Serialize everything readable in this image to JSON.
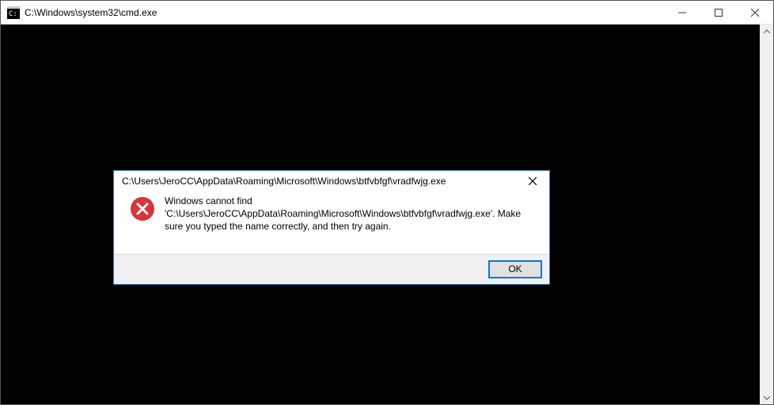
{
  "window": {
    "title": "C:\\Windows\\system32\\cmd.exe"
  },
  "dialog": {
    "title": "C:\\Users\\JeroCC\\AppData\\Roaming\\Microsoft\\Windows\\btfvbfgf\\vradfwjg.exe",
    "message": "Windows cannot find 'C:\\Users\\JeroCC\\AppData\\Roaming\\Microsoft\\Windows\\btfvbfgf\\vradfwjg.exe'. Make sure you typed the name correctly, and then try again.",
    "ok_label": "OK"
  }
}
